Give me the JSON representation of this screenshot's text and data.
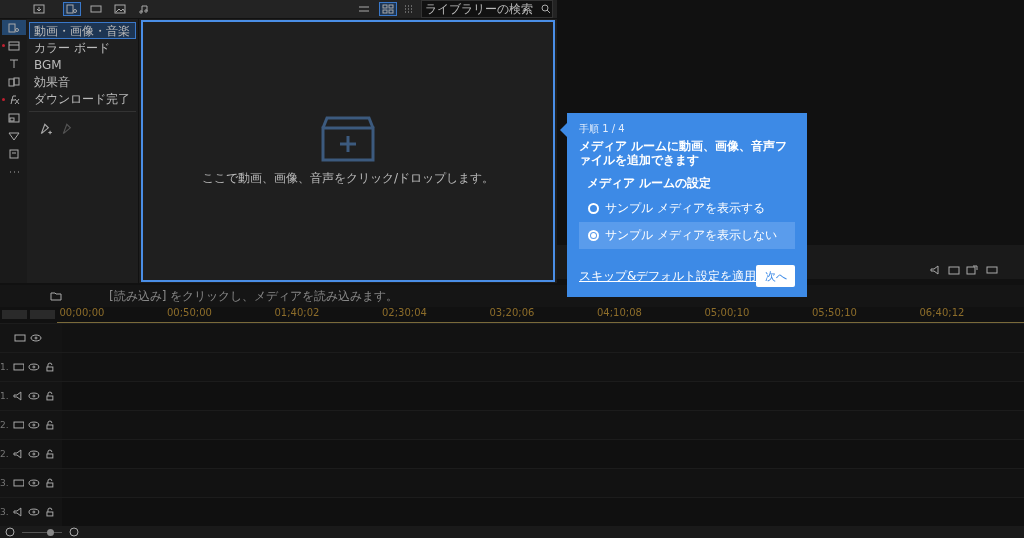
{
  "library": {
    "filter_tabs": [
      {
        "kind": "all",
        "selected": true
      },
      {
        "kind": "video",
        "selected": false
      },
      {
        "kind": "image",
        "selected": false
      },
      {
        "kind": "audio",
        "selected": false
      }
    ],
    "view_toggles": [
      {
        "kind": "list",
        "selected": false
      },
      {
        "kind": "grid",
        "selected": true
      }
    ],
    "search": {
      "placeholder": "ライブラリーの検索"
    },
    "rooms": [
      {
        "kind": "media",
        "selected": true,
        "flagged": false
      },
      {
        "kind": "storyboard",
        "selected": false,
        "flagged": true
      },
      {
        "kind": "title",
        "selected": false,
        "flagged": false
      },
      {
        "kind": "transition",
        "selected": false,
        "flagged": false
      },
      {
        "kind": "fx",
        "selected": false,
        "flagged": true
      },
      {
        "kind": "pip",
        "selected": false,
        "flagged": false
      },
      {
        "kind": "particle",
        "selected": false,
        "flagged": false
      },
      {
        "kind": "chapter",
        "selected": false,
        "flagged": false
      },
      {
        "kind": "more",
        "selected": false,
        "flagged": false
      }
    ],
    "categories": [
      {
        "label": "動画・画像・音楽",
        "selected": true
      },
      {
        "label": "カラー ボード",
        "selected": false
      },
      {
        "label": "BGM",
        "selected": false
      },
      {
        "label": "効果音",
        "selected": false
      },
      {
        "label": "ダウンロード完了",
        "selected": false
      }
    ],
    "drop_hint": "ここで動画、画像、音声をクリック/ドロップします。"
  },
  "tour": {
    "step": "手順 1 / 4",
    "heading": "メディア ルームに動画、画像、音声ファイルを追加できます",
    "section": "メディア ルームの設定",
    "options": [
      {
        "label": "サンプル メディアを表示する",
        "selected": false
      },
      {
        "label": "サンプル メディアを表示しない",
        "selected": true
      }
    ],
    "skip_link": "スキップ&デフォルト設定を適用",
    "next_button": "次へ"
  },
  "timeline": {
    "zoom": {
      "level": 0.7
    },
    "hint": "[読み込み] をクリックし、メディアを読み込みます。",
    "ruler": [
      "00;00;00",
      "00;50;00",
      "01;40;02",
      "02;30;04",
      "03;20;06",
      "04;10;08",
      "05;00;10",
      "05;50;10",
      "06;40;12"
    ],
    "tracks": [
      {
        "number": "1.",
        "kind": "video"
      },
      {
        "number": "1.",
        "kind": "audio"
      },
      {
        "number": "2.",
        "kind": "video"
      },
      {
        "number": "2.",
        "kind": "audio"
      },
      {
        "number": "3.",
        "kind": "video"
      },
      {
        "number": "3.",
        "kind": "audio"
      }
    ]
  }
}
